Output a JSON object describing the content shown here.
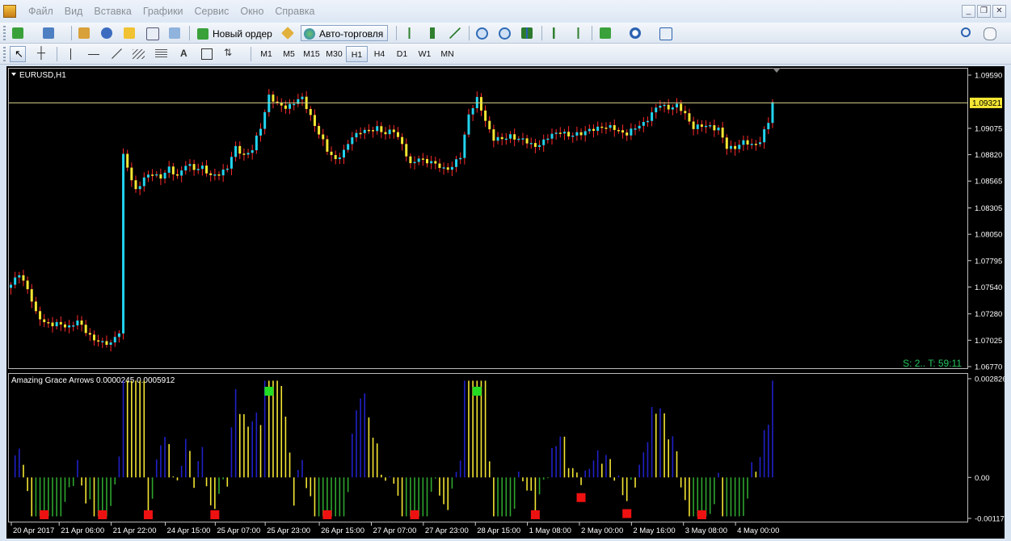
{
  "menu": {
    "items": [
      "Файл",
      "Вид",
      "Вставка",
      "Графики",
      "Сервис",
      "Окно",
      "Справка"
    ]
  },
  "toolbar": {
    "new_order_label": "Новый ордер",
    "auto_trading_label": "Авто-торговля",
    "timeframes": [
      "M1",
      "M5",
      "M15",
      "M30",
      "H1",
      "H4",
      "D1",
      "W1",
      "MN"
    ],
    "active_timeframe": "H1",
    "text_tool_label": "A"
  },
  "chart": {
    "symbol_label": "EURUSD,H1",
    "current_price": "1.09321",
    "status_text": "S: 2.. T: 59:11",
    "price_axis_labels": [
      "1.09590",
      "1.09321",
      "1.09075",
      "1.08820",
      "1.08565",
      "1.08305",
      "1.08050",
      "1.07795",
      "1.07540",
      "1.07280",
      "1.07025",
      "1.06770"
    ],
    "time_axis_labels": [
      "20 Apr 2017",
      "21 Apr 06:00",
      "21 Apr 22:00",
      "24 Apr 15:00",
      "25 Apr 07:00",
      "25 Apr 23:00",
      "26 Apr 15:00",
      "27 Apr 07:00",
      "27 Apr 23:00",
      "28 Apr 15:00",
      "1 May 08:00",
      "2 May 00:00",
      "2 May 16:00",
      "3 May 08:00",
      "4 May 00:00"
    ],
    "colors": {
      "bull": "#22d3ee",
      "bear": "#f5e633",
      "wick": "#ff2a2a",
      "price_line": "#d8d38a",
      "status": "#22c55e",
      "osc_blue": "#2020c8",
      "osc_yellow": "#f5e633",
      "osc_green": "#2ea52e",
      "arrow_up": "#22dd22",
      "arrow_down": "#ee1111"
    }
  },
  "indicator": {
    "title": "Amazing Grace Arrows 0.0000245 0.0005912",
    "axis_labels": [
      "0.002826",
      "0.00",
      "-0.001173"
    ]
  },
  "chart_data": {
    "type": "candlestick",
    "symbol": "EURUSD",
    "timeframe": "H1",
    "ylim": [
      1.0677,
      1.0959
    ],
    "current_price": 1.09321,
    "x_ticks": [
      "20 Apr 2017",
      "21 Apr 06:00",
      "21 Apr 22:00",
      "24 Apr 15:00",
      "25 Apr 07:00",
      "25 Apr 23:00",
      "26 Apr 15:00",
      "27 Apr 07:00",
      "27 Apr 23:00",
      "28 Apr 15:00",
      "1 May 08:00",
      "2 May 00:00",
      "2 May 16:00",
      "3 May 08:00",
      "4 May 00:00"
    ],
    "close_path": [
      [
        0,
        1.0755
      ],
      [
        2,
        1.0768
      ],
      [
        4,
        1.0752
      ],
      [
        6,
        1.0728
      ],
      [
        8,
        1.0721
      ],
      [
        10,
        1.0717
      ],
      [
        12,
        1.0718
      ],
      [
        14,
        1.0716
      ],
      [
        16,
        1.072
      ],
      [
        18,
        1.0712
      ],
      [
        20,
        1.0703
      ],
      [
        22,
        1.0699
      ],
      [
        24,
        1.0701
      ],
      [
        26,
        1.071
      ],
      [
        27,
        1.088
      ],
      [
        28,
        1.087
      ],
      [
        30,
        1.0848
      ],
      [
        32,
        1.0858
      ],
      [
        34,
        1.0865
      ],
      [
        36,
        1.086
      ],
      [
        38,
        1.0868
      ],
      [
        40,
        1.0862
      ],
      [
        42,
        1.0872
      ],
      [
        44,
        1.0868
      ],
      [
        46,
        1.0871
      ],
      [
        48,
        1.086
      ],
      [
        50,
        1.0864
      ],
      [
        52,
        1.087
      ],
      [
        54,
        1.0888
      ],
      [
        56,
        1.0882
      ],
      [
        58,
        1.0887
      ],
      [
        60,
        1.0908
      ],
      [
        62,
        1.094
      ],
      [
        64,
        1.093
      ],
      [
        66,
        1.0928
      ],
      [
        68,
        1.0933
      ],
      [
        70,
        1.0936
      ],
      [
        72,
        1.092
      ],
      [
        74,
        1.0902
      ],
      [
        76,
        1.0886
      ],
      [
        78,
        1.0878
      ],
      [
        80,
        1.0884
      ],
      [
        82,
        1.09
      ],
      [
        84,
        1.0905
      ],
      [
        86,
        1.0904
      ],
      [
        88,
        1.0909
      ],
      [
        90,
        1.0902
      ],
      [
        92,
        1.0905
      ],
      [
        94,
        1.0893
      ],
      [
        96,
        1.0871
      ],
      [
        98,
        1.0879
      ],
      [
        100,
        1.0876
      ],
      [
        102,
        1.0872
      ],
      [
        104,
        1.0869
      ],
      [
        106,
        1.087
      ],
      [
        108,
        1.088
      ],
      [
        110,
        1.0922
      ],
      [
        112,
        1.0935
      ],
      [
        114,
        1.0915
      ],
      [
        116,
        1.0898
      ],
      [
        118,
        1.0896
      ],
      [
        120,
        1.0901
      ],
      [
        122,
        1.0897
      ],
      [
        124,
        1.0894
      ],
      [
        126,
        1.0891
      ],
      [
        128,
        1.0894
      ],
      [
        130,
        1.0902
      ],
      [
        132,
        1.0905
      ],
      [
        134,
        1.0899
      ],
      [
        136,
        1.0903
      ],
      [
        138,
        1.0904
      ],
      [
        140,
        1.0906
      ],
      [
        142,
        1.091
      ],
      [
        144,
        1.0908
      ],
      [
        146,
        1.0905
      ],
      [
        148,
        1.0903
      ],
      [
        150,
        1.0907
      ],
      [
        152,
        1.0913
      ],
      [
        154,
        1.0922
      ],
      [
        156,
        1.093
      ],
      [
        158,
        1.0928
      ],
      [
        160,
        1.0929
      ],
      [
        162,
        1.0921
      ],
      [
        164,
        1.0909
      ],
      [
        166,
        1.0909
      ],
      [
        168,
        1.091
      ],
      [
        170,
        1.0907
      ],
      [
        172,
        1.0888
      ],
      [
        174,
        1.089
      ],
      [
        176,
        1.0894
      ],
      [
        178,
        1.0891
      ],
      [
        180,
        1.0896
      ],
      [
        182,
        1.0913
      ],
      [
        183,
        1.0932
      ]
    ],
    "indicator": {
      "name": "Amazing Grace Arrows",
      "params": [
        2.45e-05,
        0.0005912
      ],
      "ylim": [
        -0.001173,
        0.002826
      ],
      "zero_line": 0.0
    }
  }
}
